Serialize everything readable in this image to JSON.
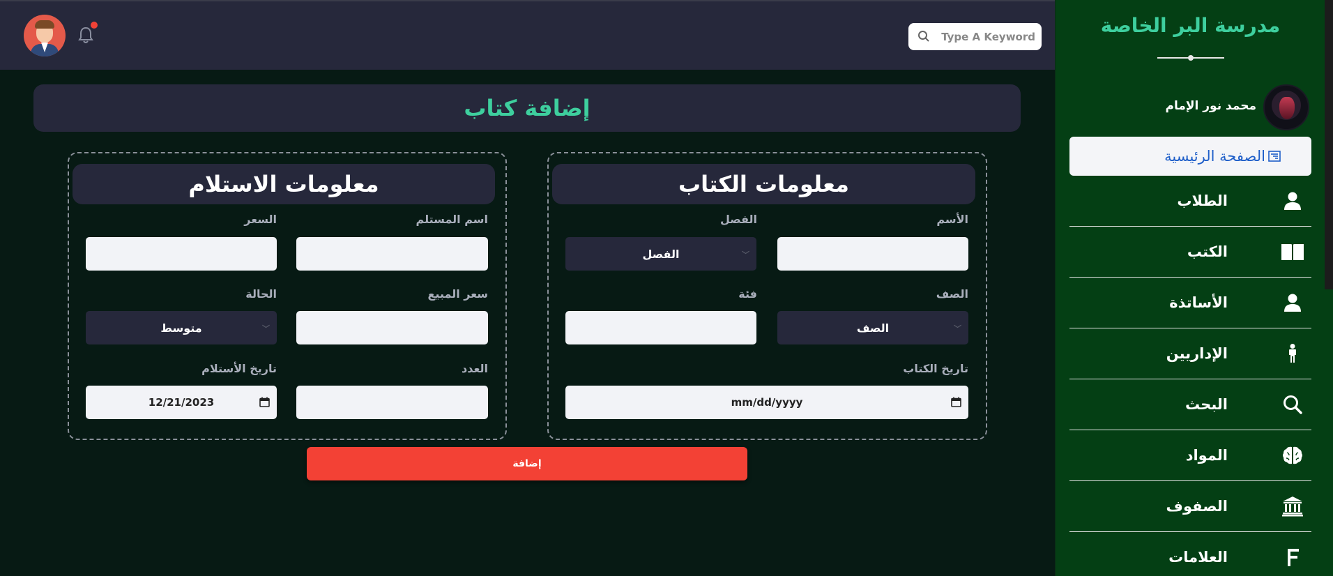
{
  "sidebar": {
    "school_name": "مدرسة البر الخاصة",
    "profile_name": "محمد نور الإمام",
    "items": [
      {
        "label": "الصفحة الرئيسية",
        "icon": "dashboard-icon",
        "active": true
      },
      {
        "label": "الطلاب",
        "icon": "user-icon"
      },
      {
        "label": "الكتب",
        "icon": "book-icon"
      },
      {
        "label": "الأساتذة",
        "icon": "user-icon"
      },
      {
        "label": "الإداريين",
        "icon": "person-standing-icon"
      },
      {
        "label": "البحث",
        "icon": "search-icon"
      },
      {
        "label": "المواد",
        "icon": "brain-icon"
      },
      {
        "label": "الصفوف",
        "icon": "building-columns-icon"
      },
      {
        "label": "العلامات",
        "icon": "letter-f-icon"
      }
    ]
  },
  "header": {
    "search_placeholder": "Type A Keyword",
    "notification_badge_color": "#f14236"
  },
  "main": {
    "page_title": "إضافة كتاب",
    "book_info": {
      "title": "معلومات الكتاب",
      "fields": {
        "name_label": "الأسم",
        "name_value": "",
        "semester_label": "الفصل",
        "semester_selected": "الفصل",
        "grade_label": "الصف",
        "grade_selected": "الصف",
        "category_label": "فئة",
        "category_value": "",
        "book_date_label": "تاريخ الكتاب",
        "book_date_value": "mm/dd/yyyy"
      }
    },
    "receipt_info": {
      "title": "معلومات الاستلام",
      "fields": {
        "recipient_label": "اسم المستلم",
        "recipient_value": "",
        "price_label": "السعر",
        "price_value": "",
        "sale_price_label": "سعر المبيع",
        "sale_price_value": "",
        "condition_label": "الحالة",
        "condition_selected": "متوسط",
        "count_label": "العدد",
        "count_value": "",
        "receipt_date_label": "تاريخ الأستلام",
        "receipt_date_value": "12/21/2023"
      }
    },
    "submit_label": "إضافة"
  },
  "colors": {
    "accent": "#3ecf9e",
    "sidebar_bg": "#043f14",
    "header_bg": "#26283b",
    "page_bg": "#071a14",
    "active_nav_text": "#1f5fc9",
    "submit_bg": "#f34135"
  }
}
